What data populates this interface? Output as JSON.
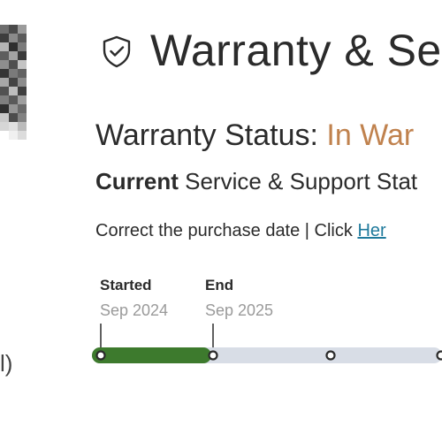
{
  "thumbnail": {
    "pixels": [
      "#6d6d6d",
      "#4a4a4a",
      "#9b9b9b",
      "#3d3d3d",
      "#8a8a8a",
      "#5b5b5b",
      "#b5b5b5",
      "#2f2f2f",
      "#7c7c7c",
      "#5e5e5e",
      "#a2a2a2",
      "#3a3a3a",
      "#8e8e8e",
      "#4f4f4f",
      "#c4c4c4",
      "#353535",
      "#7a7a7a",
      "#626262",
      "#a8a8a8",
      "#444444",
      "#8c8c8c",
      "#525252",
      "#bdbdbd",
      "#3f3f3f",
      "#7f7f7f",
      "#5a5a5a",
      "#9e9e9e",
      "#303030",
      "#959595",
      "#6a6a6a",
      "#c9c9c9",
      "#4c4c4c",
      "#828282",
      "#d6d6d6",
      "#e0e0e0",
      "#bbbbbb",
      "#ffffff",
      "#f0f0f0",
      "#dcdcdc"
    ]
  },
  "side_text": "l)",
  "header": {
    "icon": "shield-check-icon",
    "title": "Warranty & Se"
  },
  "status": {
    "label": "Warranty Status: ",
    "value": "In War",
    "value_color": "#c0824e"
  },
  "current": {
    "bold": "Current",
    "rest": " Service & Support Stat"
  },
  "correct": {
    "text": "Correct the purchase date | Click ",
    "link": "Her"
  },
  "milestones": {
    "started": {
      "label": "Started",
      "date": "Sep 2024"
    },
    "end": {
      "label": "End",
      "date": "Sep 2025"
    }
  },
  "timeline": {
    "progress_fraction": 0.34,
    "active_color": "#3d7a2d",
    "track_color": "#d8dde6"
  }
}
